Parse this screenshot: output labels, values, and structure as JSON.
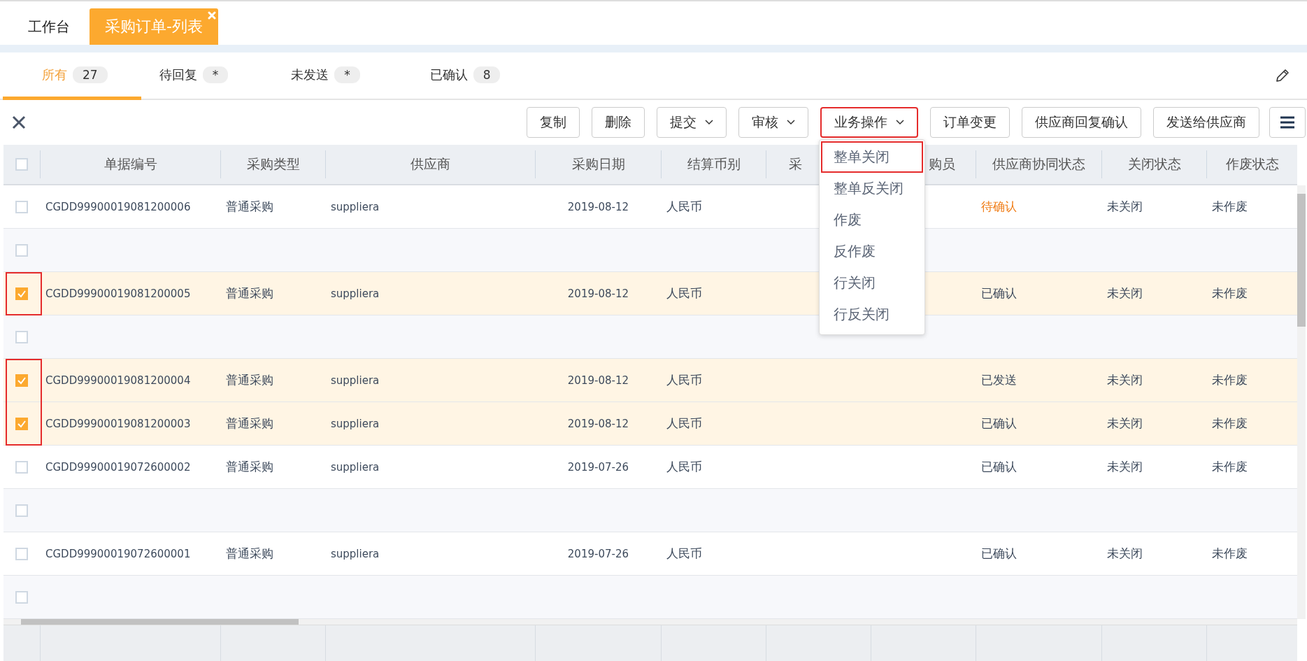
{
  "top_tabs": [
    {
      "label": "工作台",
      "selected": false
    },
    {
      "label": "采购订单-列表",
      "selected": true
    }
  ],
  "filter_tabs": [
    {
      "label": "所有",
      "count": "27",
      "selected": true
    },
    {
      "label": "待回复",
      "count": "*",
      "selected": false
    },
    {
      "label": "未发送",
      "count": "*",
      "selected": false
    },
    {
      "label": "已确认",
      "count": "8",
      "selected": false
    }
  ],
  "toolbar": {
    "buttons": [
      {
        "label": "复制",
        "kind": "plain",
        "highlighted": false
      },
      {
        "label": "删除",
        "kind": "plain",
        "highlighted": false
      },
      {
        "label": "提交",
        "kind": "dropdown",
        "highlighted": false
      },
      {
        "label": "审核",
        "kind": "dropdown",
        "highlighted": false
      },
      {
        "label": "业务操作",
        "kind": "dropdown",
        "highlighted": true,
        "expanded": true
      },
      {
        "label": "订单变更",
        "kind": "plain",
        "highlighted": false
      },
      {
        "label": "供应商回复确认",
        "kind": "plain",
        "highlighted": false
      },
      {
        "label": "发送给供应商",
        "kind": "plain",
        "highlighted": false
      }
    ],
    "menu_items": [
      {
        "label": "整单关闭",
        "highlighted": true
      },
      {
        "label": "整单反关闭",
        "highlighted": false
      },
      {
        "label": "作废",
        "highlighted": false
      },
      {
        "label": "反作废",
        "highlighted": false
      },
      {
        "label": "行关闭",
        "highlighted": false
      },
      {
        "label": "行反关闭",
        "highlighted": false
      }
    ]
  },
  "table": {
    "header_checked": false,
    "columns": [
      "单据编号",
      "采购类型",
      "供应商",
      "采购日期",
      "结算币别",
      "采",
      "购员",
      "供应商协同状态",
      "关闭状态",
      "作废状态"
    ],
    "rows": [
      {
        "kind": "order",
        "checked": false,
        "cells": [
          "CGDD99900019081200006",
          "普通采购",
          "suppliera",
          "2019-08-12",
          "人民币",
          "",
          "",
          {
            "text": "待确认",
            "color": "#f07d17"
          },
          "未关闭",
          "未作废"
        ]
      },
      {
        "kind": "blank",
        "checked": false
      },
      {
        "kind": "order",
        "checked": true,
        "frame_top": true,
        "frame_bottom": true,
        "cells": [
          "CGDD99900019081200005",
          "普通采购",
          "suppliera",
          "2019-08-12",
          "人民币",
          "",
          "",
          {
            "text": "已确认",
            "color": "#3d4a5c"
          },
          "未关闭",
          "未作废"
        ]
      },
      {
        "kind": "blank",
        "checked": false
      },
      {
        "kind": "order",
        "checked": true,
        "frame_top": true,
        "frame_bottom": false,
        "cells": [
          "CGDD99900019081200004",
          "普通采购",
          "suppliera",
          "2019-08-12",
          "人民币",
          "",
          "",
          {
            "text": "已发送",
            "color": "#3d4a5c"
          },
          "未关闭",
          "未作废"
        ]
      },
      {
        "kind": "order",
        "checked": true,
        "frame_top": false,
        "frame_bottom": true,
        "cells": [
          "CGDD99900019081200003",
          "普通采购",
          "suppliera",
          "2019-08-12",
          "人民币",
          "",
          "",
          {
            "text": "已确认",
            "color": "#3d4a5c"
          },
          "未关闭",
          "未作废"
        ]
      },
      {
        "kind": "order",
        "checked": false,
        "cells": [
          "CGDD99900019072600002",
          "普通采购",
          "suppliera",
          "2019-07-26",
          "人民币",
          "",
          "",
          {
            "text": "已确认",
            "color": "#3d4a5c"
          },
          "未关闭",
          "未作废"
        ]
      },
      {
        "kind": "blank",
        "checked": false
      },
      {
        "kind": "order",
        "checked": false,
        "cells": [
          "CGDD99900019072600001",
          "普通采购",
          "suppliera",
          "2019-07-26",
          "人民币",
          "",
          "",
          {
            "text": "已确认",
            "color": "#3d4a5c"
          },
          "未关闭",
          "未作废"
        ]
      },
      {
        "kind": "blank",
        "checked": false
      }
    ]
  }
}
